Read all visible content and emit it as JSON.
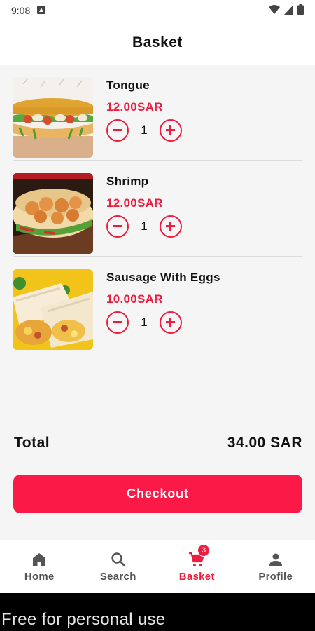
{
  "status_bar": {
    "time": "9:08"
  },
  "header": {
    "title": "Basket"
  },
  "items": [
    {
      "name": "Tongue",
      "price": "12.00SAR",
      "quantity": "1"
    },
    {
      "name": "Shrimp",
      "price": "12.00SAR",
      "quantity": "1"
    },
    {
      "name": "Sausage With Eggs",
      "price": "10.00SAR",
      "quantity": "1"
    }
  ],
  "summary": {
    "total_label": "Total",
    "total_value": "34.00 SAR"
  },
  "checkout": {
    "label": "Checkout"
  },
  "nav": {
    "items": [
      {
        "label": "Home",
        "icon": "home-icon"
      },
      {
        "label": "Search",
        "icon": "search-icon"
      },
      {
        "label": "Basket",
        "icon": "cart-icon",
        "badge": "3",
        "active": true
      },
      {
        "label": "Profile",
        "icon": "person-icon"
      }
    ]
  },
  "watermark": {
    "text": "Free for personal use"
  },
  "colors": {
    "accent": "#ee1c3e",
    "button": "#fb1a47",
    "background": "#f5f5f5"
  }
}
